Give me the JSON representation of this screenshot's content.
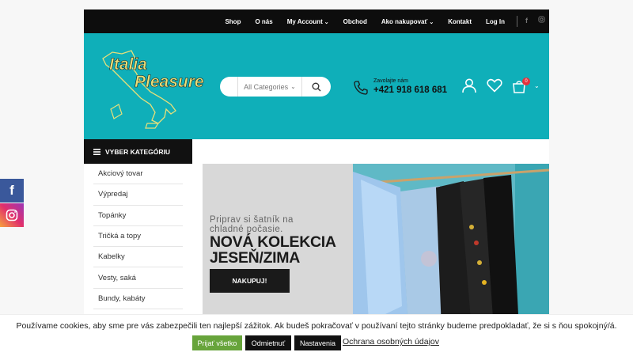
{
  "topnav": {
    "items": [
      {
        "label": "Shop",
        "dropdown": false
      },
      {
        "label": "O nás",
        "dropdown": false
      },
      {
        "label": "My Account",
        "dropdown": true
      },
      {
        "label": "Obchod",
        "dropdown": false
      },
      {
        "label": "Ako nakupovať",
        "dropdown": true
      },
      {
        "label": "Kontakt",
        "dropdown": false
      },
      {
        "label": "Log In",
        "dropdown": false
      }
    ],
    "social_icons": [
      "facebook-icon",
      "instagram-icon"
    ]
  },
  "header": {
    "logo_line1": "Italia",
    "logo_line2": "Pleasure",
    "search": {
      "category_label": "All Categories",
      "icon": "search-icon"
    },
    "phone": {
      "label": "Zavolajte nám",
      "number": "+421 918 618 681",
      "icon": "phone-icon"
    },
    "cart_count": "0",
    "icons": [
      "user-icon",
      "heart-icon",
      "cart-icon"
    ],
    "colors": {
      "header_bg": "#0fafb9",
      "topbar_bg": "#0d0d0d"
    }
  },
  "sidebar": {
    "title": "VYBER KATEGÓRIU",
    "items": [
      "Akciový tovar",
      "Výpredaj",
      "Topánky",
      "Tričká a topy",
      "Kabelky",
      "Vesty, saká",
      "Bundy, kabáty"
    ]
  },
  "hero": {
    "subtitle": "Priprav si šatník na chladné počasie.",
    "title_line1": "NOVÁ KOLEKCIA",
    "title_line2": "JESEŇ/ZIMA",
    "button": "NAKUPUJ!"
  },
  "floating_social": [
    "facebook-icon",
    "instagram-icon"
  ],
  "cookie": {
    "message": "Používame cookies, aby sme pre vás zabezpečili ten najlepší zážitok. Ak budeš pokračovať v používaní tejto stránky budeme predpokladať, že si s ňou spokojný/á.",
    "accept": "Prijať všetko",
    "reject": "Odmietnuť",
    "settings": "Nastavenia",
    "policy": "Ochrana osobných údajov",
    "colors": {
      "accept": "#67a43b",
      "dark": "#111111"
    }
  }
}
